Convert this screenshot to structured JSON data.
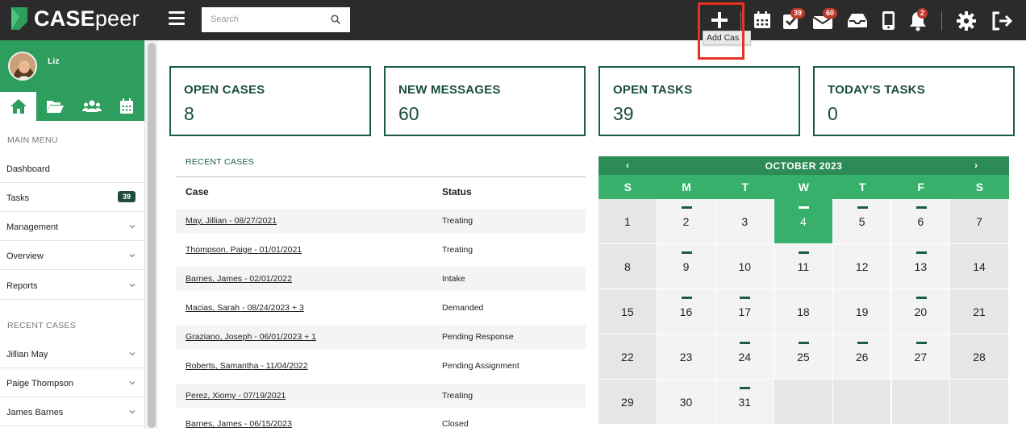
{
  "brand": {
    "name_bold": "CASE",
    "name_light": "peer"
  },
  "search": {
    "placeholder": "Search"
  },
  "topbar": {
    "add_case_tooltip": "Add Cas",
    "tasks_badge": "39",
    "messages_badge": "60",
    "notifications_badge": "2"
  },
  "user": {
    "name": "Liz"
  },
  "sidebar": {
    "main_menu_label": "MAIN MENU",
    "items": [
      {
        "label": "Dashboard"
      },
      {
        "label": "Tasks",
        "badge": "39"
      },
      {
        "label": "Management"
      },
      {
        "label": "Overview"
      },
      {
        "label": "Reports"
      }
    ],
    "recent_cases_label": "RECENT CASES",
    "recent": [
      {
        "label": "Jillian May"
      },
      {
        "label": "Paige Thompson"
      },
      {
        "label": "James Barnes"
      }
    ]
  },
  "stats": [
    {
      "title": "OPEN CASES",
      "value": "8"
    },
    {
      "title": "NEW MESSAGES",
      "value": "60"
    },
    {
      "title": "OPEN TASKS",
      "value": "39"
    },
    {
      "title": "TODAY'S TASKS",
      "value": "0"
    }
  ],
  "recent_cases": {
    "title": "RECENT CASES",
    "col_case": "Case",
    "col_status": "Status",
    "rows": [
      {
        "case": "May, Jillian - 08/27/2021",
        "status": "Treating"
      },
      {
        "case": "Thompson, Paige - 01/01/2021",
        "status": "Treating"
      },
      {
        "case": "Barnes, James - 02/01/2022",
        "status": "Intake"
      },
      {
        "case": "Macias, Sarah - 08/24/2023 + 3",
        "status": "Demanded"
      },
      {
        "case": "Graziano, Joseph - 06/01/2023 + 1",
        "status": "Pending Response"
      },
      {
        "case": "Roberts, Samantha - 11/04/2022",
        "status": "Pending Assignment"
      },
      {
        "case": "Perez, Xiomy - 07/19/2021",
        "status": "Treating"
      },
      {
        "case": "Barnes, James - 06/15/2023",
        "status": "Closed"
      }
    ]
  },
  "calendar": {
    "month": "OCTOBER 2023",
    "prev": "‹",
    "next": "›",
    "weekdays": [
      "S",
      "M",
      "T",
      "W",
      "T",
      "F",
      "S"
    ],
    "today": 4,
    "marked_days": [
      2,
      4,
      5,
      6,
      9,
      11,
      13,
      16,
      17,
      20,
      24,
      25,
      26,
      27,
      31
    ],
    "days_in_month": 31,
    "first_weekday": 0
  },
  "colors": {
    "brand_green": "#2e9e5e",
    "dark_green": "#1a5c48",
    "topbar": "#2b2b2b",
    "badge_red": "#c0392b",
    "highlight_red": "#e53323"
  }
}
